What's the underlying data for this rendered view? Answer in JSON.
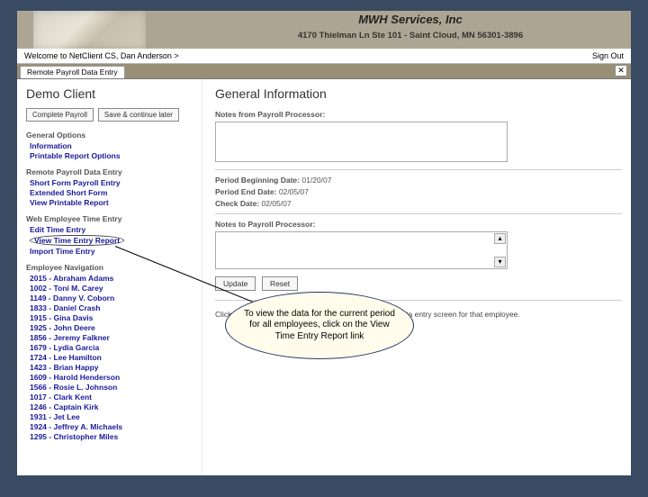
{
  "banner": {
    "title": "MWH Services, Inc",
    "subtitle": "4170 Thielman Ln Ste 101 - Saint Cloud, MN 56301-3896"
  },
  "welcome": {
    "text": "Welcome to NetClient CS, Dan Anderson  >",
    "signout": "Sign Out"
  },
  "tab": "Remote Payroll Data Entry",
  "left": {
    "client": "Demo Client",
    "buttons": {
      "complete": "Complete Payroll",
      "save": "Save & continue later"
    },
    "groups": {
      "general": {
        "head": "General Options",
        "items": [
          "Information",
          "Printable Report Options"
        ]
      },
      "rpde": {
        "head": "Remote Payroll Data Entry",
        "items": [
          "Short Form Payroll Entry",
          "Extended Short Form",
          "View Printable Report"
        ]
      },
      "wete": {
        "head": "Web Employee Time Entry",
        "items": [
          "Edit Time Entry",
          "View Time Entry Report",
          "Import Time Entry"
        ]
      }
    },
    "empnav": {
      "head": "Employee Navigation",
      "items": [
        "2015 - Abraham Adams",
        "1002 - Toni M. Carey",
        "1149 - Danny V. Coborn",
        "1833 - Daniel Crash",
        "1915 - Gina Davis",
        "1925 - John Deere",
        "1856 - Jeremy Falkner",
        "1679 - Lydia Garcia",
        "1724 - Lee Hamilton",
        "1423 - Brian Happy",
        "1609 - Harold Henderson",
        "1566 - Rosie L. Johnson",
        "1017 - Clark Kent",
        "1246 - Captain Kirk",
        "1931 - Jet Lee",
        "1924 - Jeffrey A. Michaels",
        "1295 - Christopher Miles"
      ]
    }
  },
  "right": {
    "title": "General Information",
    "labels": {
      "notesfrom": "Notes from Payroll Processor:",
      "begin": "Period Beginning Date:",
      "end": "Period End Date:",
      "check": "Check Date:",
      "notesto": "Notes to Payroll Processor:"
    },
    "dates": {
      "begin": "01/20/07",
      "end": "02/05/07",
      "check": "02/05/07"
    },
    "buttons": {
      "update": "Update",
      "reset": "Reset"
    },
    "hint": "Click on an employee in the left column to access the data entry screen for that employee."
  },
  "callout": "To view the data for the current period for all employees, click on the View Time Entry Report link"
}
